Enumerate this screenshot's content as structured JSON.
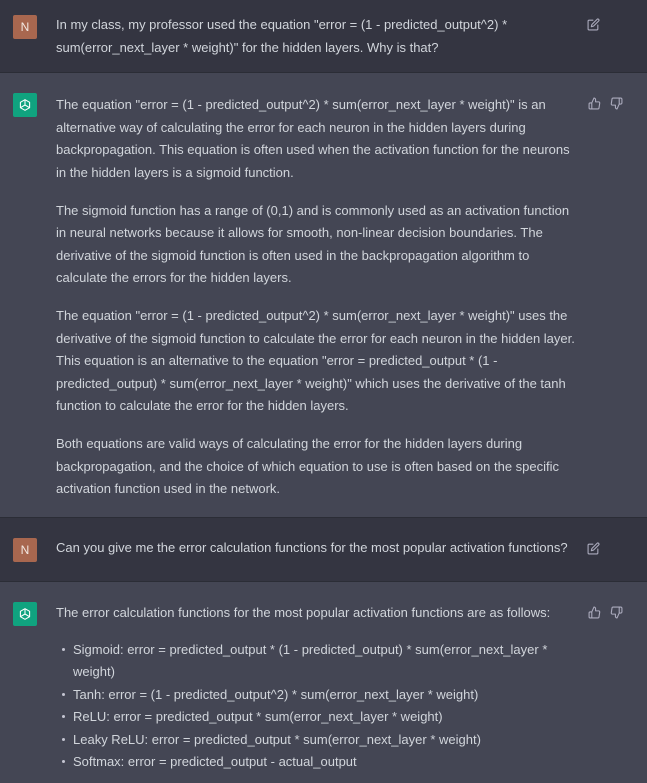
{
  "messages": [
    {
      "role": "user",
      "avatar": "N",
      "text": "In my class, my professor used the equation \"error = (1 - predicted_output^2) * sum(error_next_layer * weight)\" for the hidden layers. Why is that?"
    },
    {
      "role": "assistant",
      "paragraphs": [
        "The equation \"error = (1 - predicted_output^2) * sum(error_next_layer * weight)\" is an alternative way of calculating the error for each neuron in the hidden layers during backpropagation. This equation is often used when the activation function for the neurons in the hidden layers is a sigmoid function.",
        "The sigmoid function has a range of (0,1) and is commonly used as an activation function in neural networks because it allows for smooth, non-linear decision boundaries. The derivative of the sigmoid function is often used in the backpropagation algorithm to calculate the errors for the hidden layers.",
        "The equation \"error = (1 - predicted_output^2) * sum(error_next_layer * weight)\" uses the derivative of the sigmoid function to calculate the error for each neuron in the hidden layer. This equation is an alternative to the equation \"error = predicted_output * (1 - predicted_output) * sum(error_next_layer * weight)\" which uses the derivative of the tanh function to calculate the error for the hidden layers.",
        "Both equations are valid ways of calculating the error for the hidden layers during backpropagation, and the choice of which equation to use is often based on the specific activation function used in the network."
      ]
    },
    {
      "role": "user",
      "avatar": "N",
      "text": "Can you give me the error calculation functions for the most popular activation functions?"
    },
    {
      "role": "assistant",
      "intro": "The error calculation functions for the most popular activation functions are as follows:",
      "list": [
        "Sigmoid: error = predicted_output * (1 - predicted_output) * sum(error_next_layer * weight)",
        "Tanh: error = (1 - predicted_output^2) * sum(error_next_layer * weight)",
        "ReLU: error = predicted_output * sum(error_next_layer * weight)",
        "Leaky ReLU: error = predicted_output * sum(error_next_layer * weight)",
        "Softmax: error = predicted_output - actual_output"
      ]
    }
  ],
  "icons": {
    "edit": "edit-icon",
    "thumbs_up": "thumbs-up-icon",
    "thumbs_down": "thumbs-down-icon",
    "assistant_logo": "openai-logo-icon"
  },
  "colors": {
    "user_bg": "#343541",
    "assistant_bg": "#444654",
    "user_avatar": "#a8674f",
    "assistant_avatar": "#10a37f",
    "text": "#d1d5db"
  }
}
